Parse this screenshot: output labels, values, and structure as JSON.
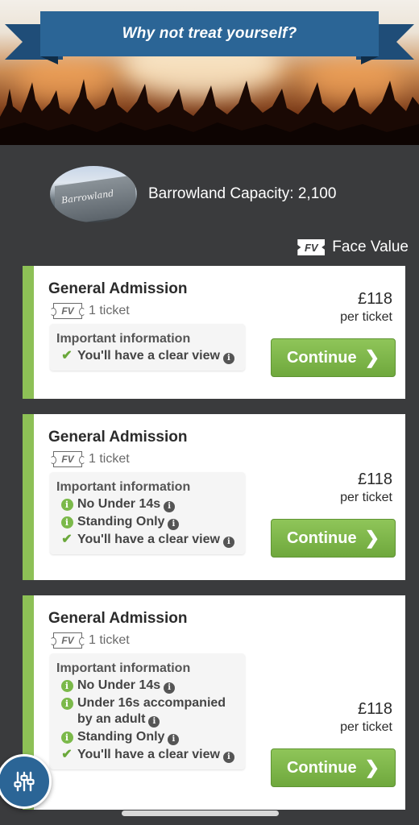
{
  "banner": {
    "title": "Why not treat yourself?"
  },
  "venue": {
    "info": "Barrowland Capacity: 2,100",
    "sign_text": "Barrowland"
  },
  "legend": {
    "badge": "FV",
    "label": "Face Value"
  },
  "colors": {
    "accent_green": "#8dc056",
    "banner_blue": "#2b6596",
    "background": "#3a3b3d"
  },
  "listings": [
    {
      "title": "General Admission",
      "badge": "FV",
      "tickets": "1 ticket",
      "info_title": "Important information",
      "items": [
        {
          "icon": "check-icon",
          "text": "You'll have a clear view"
        }
      ],
      "price": "£118",
      "per": "per ticket",
      "button": "Continue"
    },
    {
      "title": "General Admission",
      "badge": "FV",
      "tickets": "1 ticket",
      "info_title": "Important information",
      "items": [
        {
          "icon": "info-icon",
          "text": "No Under 14s"
        },
        {
          "icon": "info-icon",
          "text": "Standing Only"
        },
        {
          "icon": "check-icon",
          "text": "You'll have a clear view"
        }
      ],
      "price": "£118",
      "per": "per ticket",
      "button": "Continue"
    },
    {
      "title": "General Admission",
      "badge": "FV",
      "tickets": "1 ticket",
      "info_title": "Important information",
      "items": [
        {
          "icon": "info-icon",
          "text": "No Under 14s"
        },
        {
          "icon": "info-icon",
          "text": "Under 16s accompanied by an adult"
        },
        {
          "icon": "info-icon",
          "text": "Standing Only"
        },
        {
          "icon": "check-icon",
          "text": "You'll have a clear view"
        }
      ],
      "price": "£118",
      "per": "per ticket",
      "button": "Continue"
    }
  ],
  "filter_button": {
    "icon": "sliders-icon"
  }
}
